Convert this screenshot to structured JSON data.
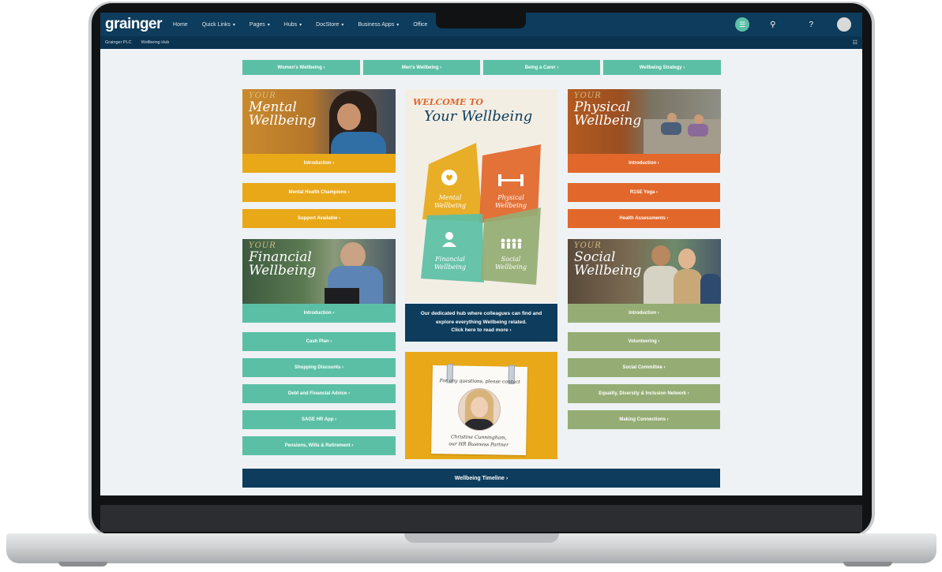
{
  "nav": {
    "logo": "grainger",
    "items": [
      "Home",
      "Quick Links",
      "Pages",
      "Hubs",
      "DocStore",
      "Business Apps",
      "Office"
    ],
    "breadcrumb": [
      "Grainger PLC",
      "Wellbeing Hub"
    ]
  },
  "top_tabs": [
    "Women's Wellbeing ›",
    "Men's Wellbeing ›",
    "Being a Carer ›",
    "Wellbeing Strategy ›"
  ],
  "mental": {
    "your": "YOUR",
    "title1": "Mental",
    "title2": "Wellbeing",
    "buttons": [
      "Introduction ›",
      "Mental Health Champions ›",
      "Support Available ›"
    ]
  },
  "financial": {
    "your": "YOUR",
    "title1": "Financial",
    "title2": "Wellbeing",
    "buttons": [
      "Introduction ›",
      "Cash Plan ›",
      "Shopping Discounts ›",
      "Debt and Financial Advice ›",
      "SAGE HR App ›",
      "Pensions, Wills & Retirement ›"
    ]
  },
  "physical": {
    "your": "YOUR",
    "title1": "Physical",
    "title2": "Wellbeing",
    "buttons": [
      "Introduction ›",
      "R1SE Yoga ›",
      "Health Assessments ›"
    ]
  },
  "social": {
    "your": "YOUR",
    "title1": "Social",
    "title2": "Wellbeing",
    "buttons": [
      "Introduction ›",
      "Volunteering ›",
      "Social Committee ›",
      "Equality, Diversity & Inclusion Network ›",
      "Making Connections ›"
    ]
  },
  "center": {
    "welcome_line1": "WELCOME TO",
    "welcome_line2": "Your Wellbeing",
    "quadrants": [
      {
        "l1": "Mental",
        "l2": "Wellbeing",
        "color": "#e8a817"
      },
      {
        "l1": "Physical",
        "l2": "Wellbeing",
        "color": "#e2672a"
      },
      {
        "l1": "Financial",
        "l2": "Wellbeing",
        "color": "#5bbfa5"
      },
      {
        "l1": "Social",
        "l2": "Wellbeing",
        "color": "#95ad74"
      }
    ],
    "hub_lines": [
      "Our dedicated hub where colleagues can find and",
      "explore everything Wellbeing related.",
      "Click here to read more ›"
    ],
    "contact_heading": "For any questions, please contact",
    "contact_name": "Christine Cunningham,",
    "contact_role": "our HR Business Partner"
  },
  "timeline_button": "Wellbeing Timeline ›",
  "colors": {
    "navy": "#0d3c5c",
    "teal": "#5bbfa5",
    "gold": "#e8a817",
    "orange": "#e2672a",
    "sage": "#95ad74"
  }
}
